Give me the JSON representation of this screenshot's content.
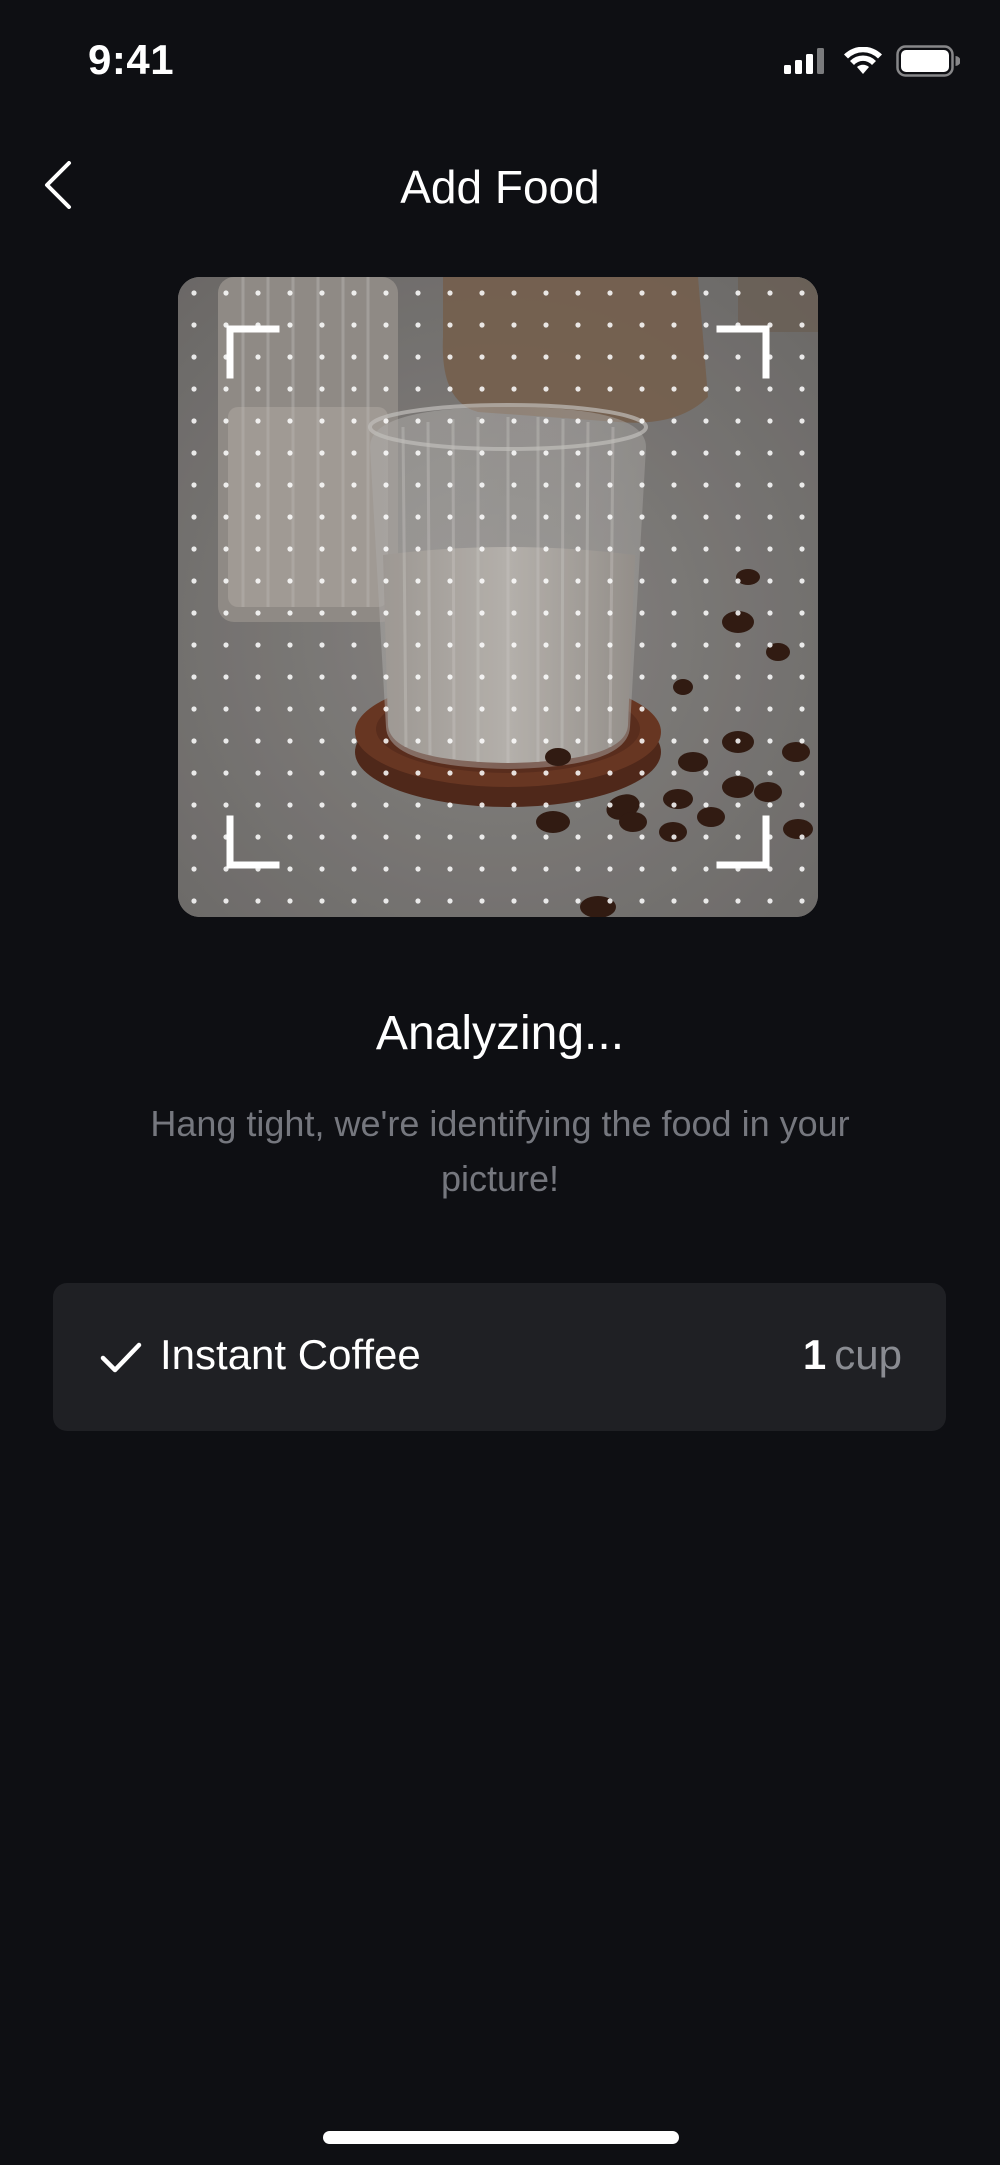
{
  "status_bar": {
    "time": "9:41",
    "icons": [
      "cellular-signal-icon",
      "wifi-icon",
      "battery-icon"
    ]
  },
  "header": {
    "back_icon": "chevron-left-icon",
    "title": "Add Food"
  },
  "photo": {
    "overlay": "scan-frame-with-dot-grid"
  },
  "analyzing": {
    "title": "Analyzing...",
    "subtitle": "Hang tight, we're identifying the food in your picture!"
  },
  "results": [
    {
      "icon": "checkmark-icon",
      "name": "Instant Coffee",
      "quantity": "1",
      "unit": "cup"
    }
  ],
  "colors": {
    "background": "#0e0f13",
    "card": "#1f2024",
    "subtitle": "#75777e",
    "unit": "#8a8c92"
  }
}
